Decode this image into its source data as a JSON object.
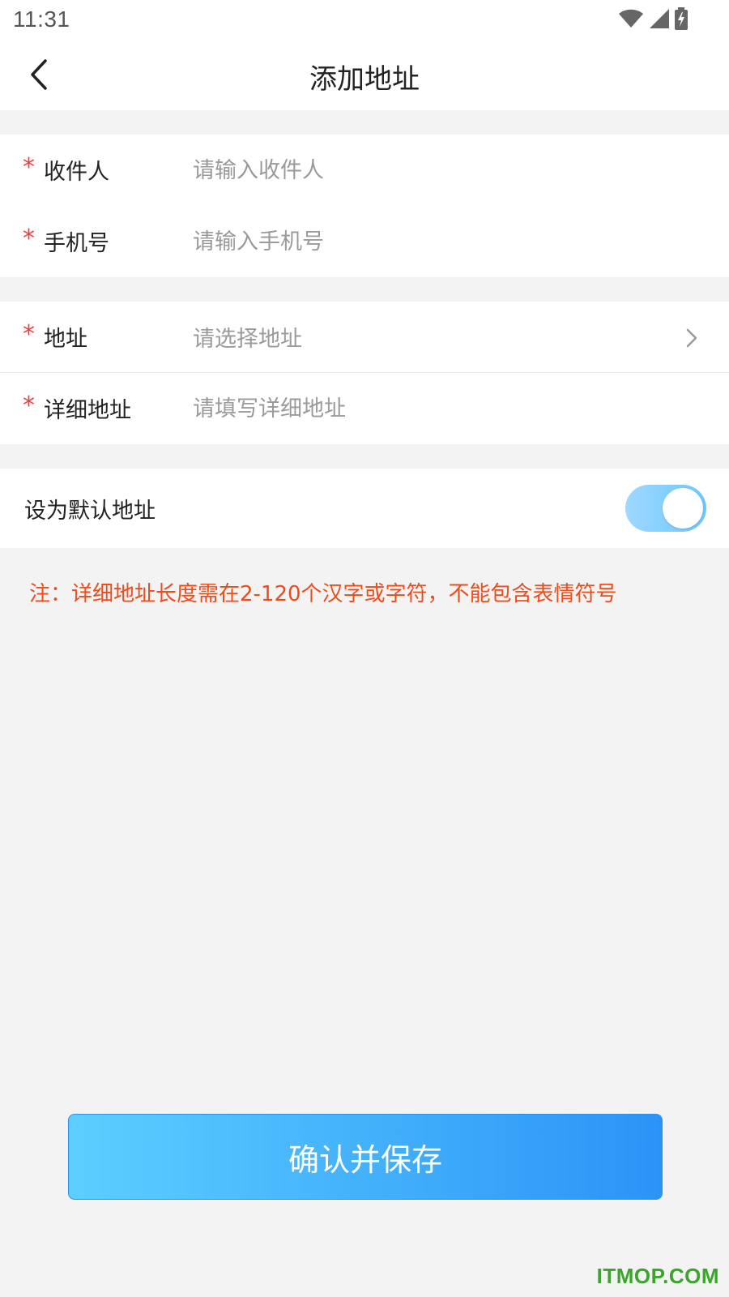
{
  "status_bar": {
    "time": "11:31",
    "icons": [
      "wifi-icon",
      "signal-icon",
      "battery-charging-icon"
    ]
  },
  "header": {
    "title": "添加地址",
    "back_icon": "chevron-left-icon"
  },
  "form": {
    "recipient": {
      "required_mark": "*",
      "label": "收件人",
      "placeholder": "请输入收件人",
      "value": ""
    },
    "phone": {
      "required_mark": "*",
      "label": "手机号",
      "placeholder": "请输入手机号",
      "value": ""
    },
    "address": {
      "required_mark": "*",
      "label": "地址",
      "placeholder": "请选择地址"
    },
    "detail_address": {
      "required_mark": "*",
      "label": "详细地址",
      "placeholder": "请填写详细地址",
      "value": ""
    },
    "default_address": {
      "label": "设为默认地址",
      "enabled": true
    }
  },
  "note": "注：详细地址长度需在2-120个汉字或字符，不能包含表情符号",
  "confirm_button": {
    "label": "确认并保存"
  },
  "watermark": "ITMOP.COM",
  "colors": {
    "required": "#f23c3c",
    "note": "#f04b1a",
    "button_start": "#5ccfff",
    "button_end": "#2b93f7",
    "toggle_on": "#6cc6ff",
    "watermark": "#3aa52b"
  }
}
